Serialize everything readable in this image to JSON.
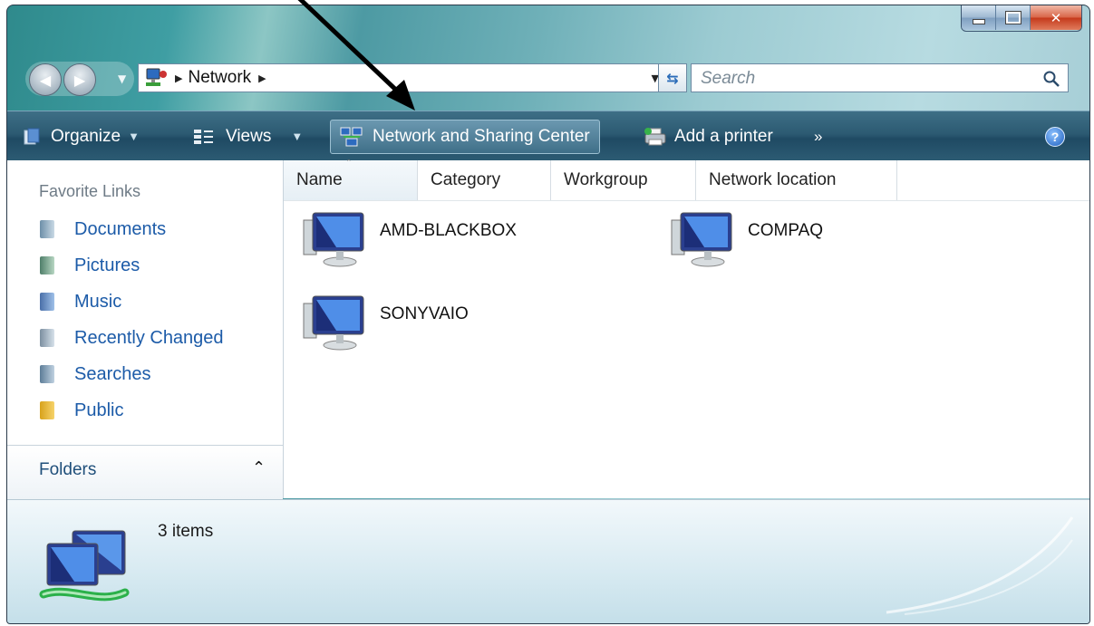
{
  "address": {
    "crumb": "Network",
    "search_placeholder": "Search"
  },
  "toolbar": {
    "organize": "Organize",
    "views": "Views",
    "network_sharing": "Network and Sharing Center",
    "add_printer": "Add a printer",
    "overflow": "»",
    "help": "?"
  },
  "nav_pane": {
    "favorite_links_title": "Favorite Links",
    "links": [
      "Documents",
      "Pictures",
      "Music",
      "Recently Changed",
      "Searches",
      "Public"
    ],
    "folders_label": "Folders"
  },
  "columns": [
    "Name",
    "Category",
    "Workgroup",
    "Network location"
  ],
  "computers": [
    "AMD-BLACKBOX",
    "COMPAQ",
    "SONYVAIO"
  ],
  "details": {
    "item_count": "3 items"
  },
  "colors": {
    "link": "#1c5ba8",
    "toolbar": "#2c5a72",
    "arrow": "#000000"
  }
}
